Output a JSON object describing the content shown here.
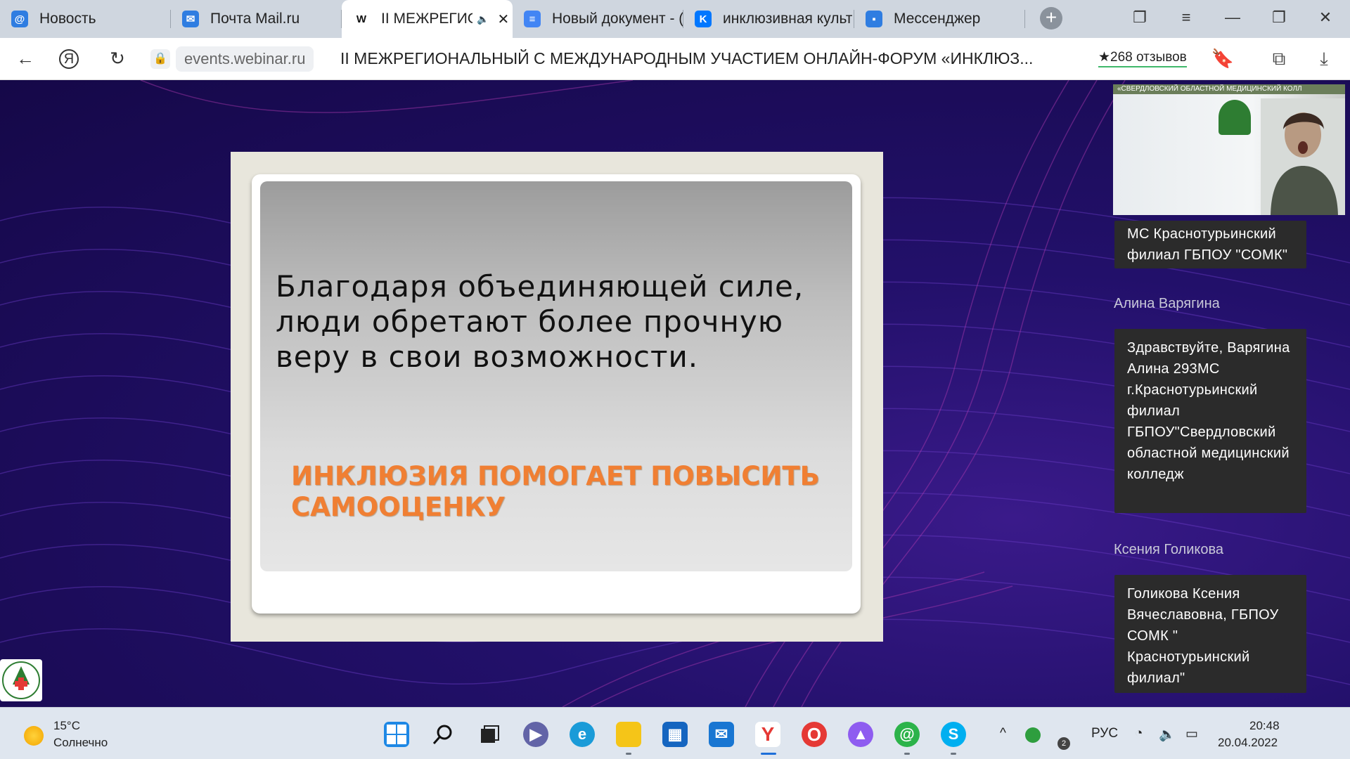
{
  "tabs": [
    {
      "label": "Новость",
      "icon": "at-icon",
      "color": "#2f7de1"
    },
    {
      "label": "Почта Mail.ru",
      "icon": "mail-icon",
      "color": "#2f7de1"
    },
    {
      "label": "II МЕЖРЕГИОН",
      "icon": "w-icon",
      "color": "#111111",
      "active": true
    },
    {
      "label": "Новый документ - (",
      "icon": "docs-icon",
      "color": "#4285f4"
    },
    {
      "label": "инклюзивная культ",
      "icon": "vk-icon",
      "color": "#0077ff"
    },
    {
      "label": "Мессенджер",
      "icon": "messenger-icon",
      "color": "#2f7de1"
    }
  ],
  "tab_icon_glyphs": {
    "at": "@",
    "mail": "✉",
    "w": "W",
    "docs": "≡",
    "vk": "K",
    "messenger": "▪"
  },
  "close_glyph": "✕",
  "audio_glyph": "🔈",
  "new_tab_glyph": "+",
  "window_controls": {
    "collections": "❐",
    "menu": "≡",
    "minimize": "—",
    "maximize": "❐",
    "close": "✕"
  },
  "addressbar": {
    "back": "←",
    "yandex": "Я",
    "reload": "↻",
    "lock": "🔒",
    "url": "events.webinar.ru",
    "page_title": "II МЕЖРЕГИОНАЛЬНЫЙ С МЕЖДУНАРОДНЫМ УЧАСТИЕМ ОНЛАЙН-ФОРУМ «ИНКЛЮЗ...",
    "reviews": "★268 отзывов",
    "bookmark": "🔖",
    "share": "⧉",
    "download": "⤓"
  },
  "slide": {
    "text": "Благодаря объединяющей силе, люди обретают более прочную веру в свои возможности.",
    "heading": "ИНКЛЮЗИЯ ПОМОГАЕТ ПОВЫСИТЬ САМООЦЕНКУ"
  },
  "video": {
    "banner": "«СВЕРДЛОВСКИЙ ОБЛАСТНОЙ МЕДИЦИНСКИЙ КОЛЛ"
  },
  "chat": {
    "first_message_tail": "МС Краснотурьинский филиал ГБПОУ \"СОМК\"",
    "messages": [
      {
        "author": "Алина Варягина",
        "text": "Здравствуйте, Варягина Алина 293МС г.Краснотурьинский филиал ГБПОУ\"Свердловский областной медицинский колледж"
      },
      {
        "author": "Ксения Голикова",
        "text": "Голикова Ксения Вячеславовна, ГБПОУ СОМК \" Краснотурьинский филиал\""
      }
    ]
  },
  "taskbar": {
    "weather_temp": "15°C",
    "weather_desc": "Солнечно",
    "apps": [
      "start-icon",
      "search-icon",
      "taskview-icon",
      "teams-icon",
      "edge-icon",
      "explorer-icon",
      "store-icon",
      "mail-icon",
      "yandex-icon",
      "opera-icon",
      "alice-icon",
      "mailru-agent-icon",
      "skype-icon"
    ],
    "language": "РУС",
    "time": "20:48",
    "date": "20.04.2022",
    "tray_glyphs": {
      "chevron": "^",
      "wifi": "◔",
      "volume": "🔈",
      "battery": "▭"
    },
    "badge": "2"
  }
}
